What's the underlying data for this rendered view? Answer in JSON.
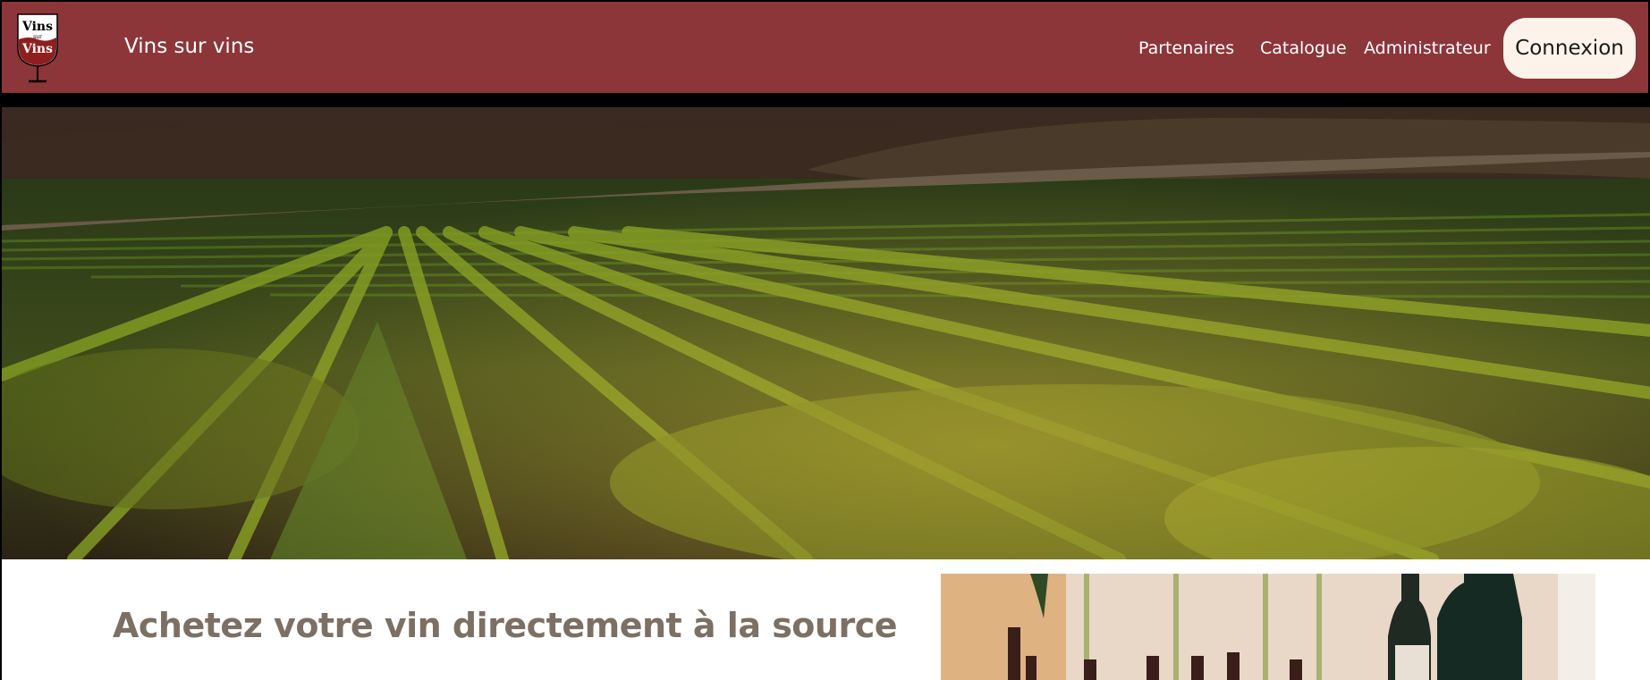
{
  "header": {
    "logo_icon": "wine-glass-logo-icon",
    "logo_text_top": "Vins",
    "logo_text_mid": "sur",
    "logo_text_bottom": "Vins",
    "brand": "Vins sur vins",
    "nav": [
      {
        "label": "Partenaires"
      },
      {
        "label": "Catalogue"
      },
      {
        "label": "Administrateur"
      }
    ],
    "login_label": "Connexion",
    "colors": {
      "header_bg": "#8c363a",
      "login_bg": "#fdf3ea"
    }
  },
  "hero": {
    "image": "vineyard-photo"
  },
  "main": {
    "tagline": "Achetez votre vin directement à la source",
    "image": "wine-bottles-photo",
    "colors": {
      "tagline": "#7c6f63"
    }
  }
}
